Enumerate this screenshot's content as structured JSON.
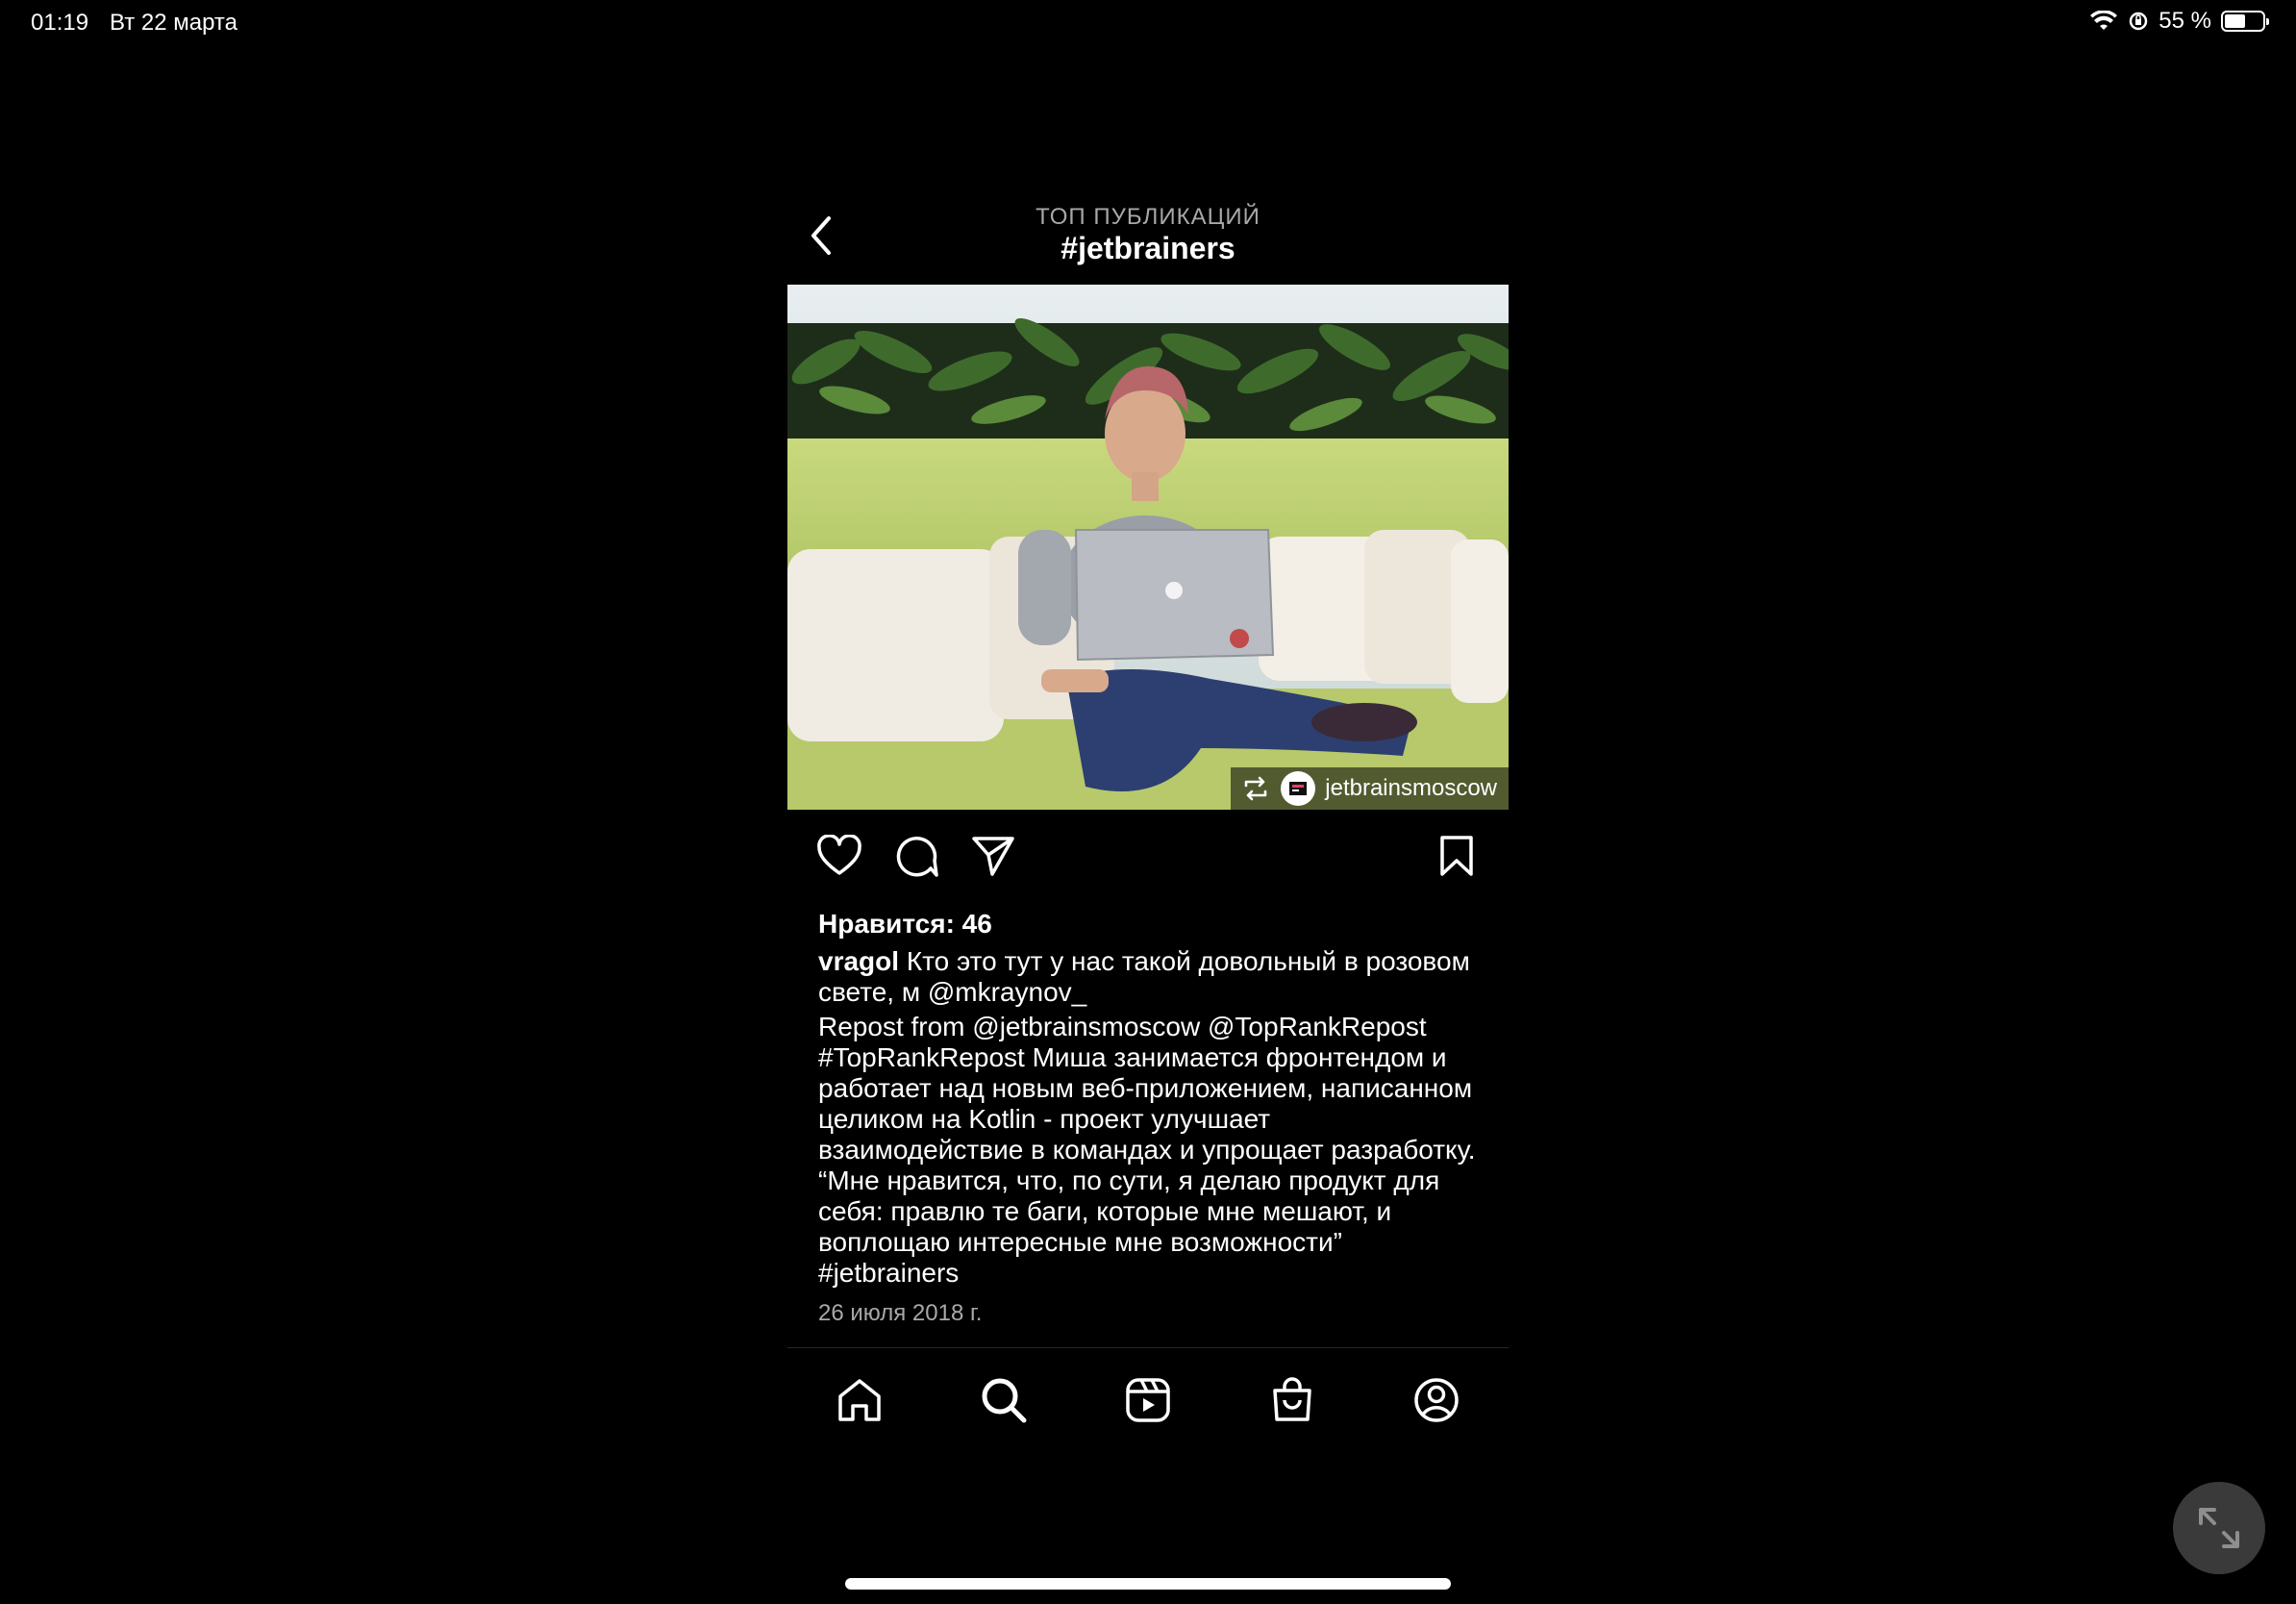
{
  "status_bar": {
    "time": "01:19",
    "date": "Вт 22 марта",
    "battery": "55 %",
    "battery_level": 0.55,
    "icons": [
      "wifi-icon",
      "orientation-lock-icon",
      "battery-icon"
    ]
  },
  "header": {
    "subtitle": "ТОП ПУБЛИКАЦИЙ",
    "title": "#jetbrainers"
  },
  "post": {
    "repost_account": "jetbrainsmoscow",
    "likes": "Нравится: 46",
    "username": "vragol",
    "caption_line1": "Кто это тут у нас такой довольный в розовом свете, м @mkraynov_",
    "caption_line2": "Repost from @jetbrainsmoscow @TopRankRepost #TopRankRepost Миша занимается фронтендом и работает над новым веб-приложением, написанном целиком на Kotlin - проект улучшает взаимодействие в командах и упрощает разработку. “Мне нравится, что, по сути, я делаю продукт для себя: правлю те баги, которые мне мешают, и воплощаю интересные мне возможности” #jetbrainers",
    "date": "26 июля 2018 г."
  },
  "actions": [
    "heart-icon",
    "comment-icon",
    "share-icon",
    "bookmark-icon"
  ],
  "tabbar": [
    "home-icon",
    "search-icon",
    "reels-icon",
    "shop-icon",
    "profile-icon"
  ],
  "colors": {
    "background": "#000000",
    "text": "#ffffff",
    "secondary_text": "#a8a8a8",
    "divider": "#262626"
  }
}
